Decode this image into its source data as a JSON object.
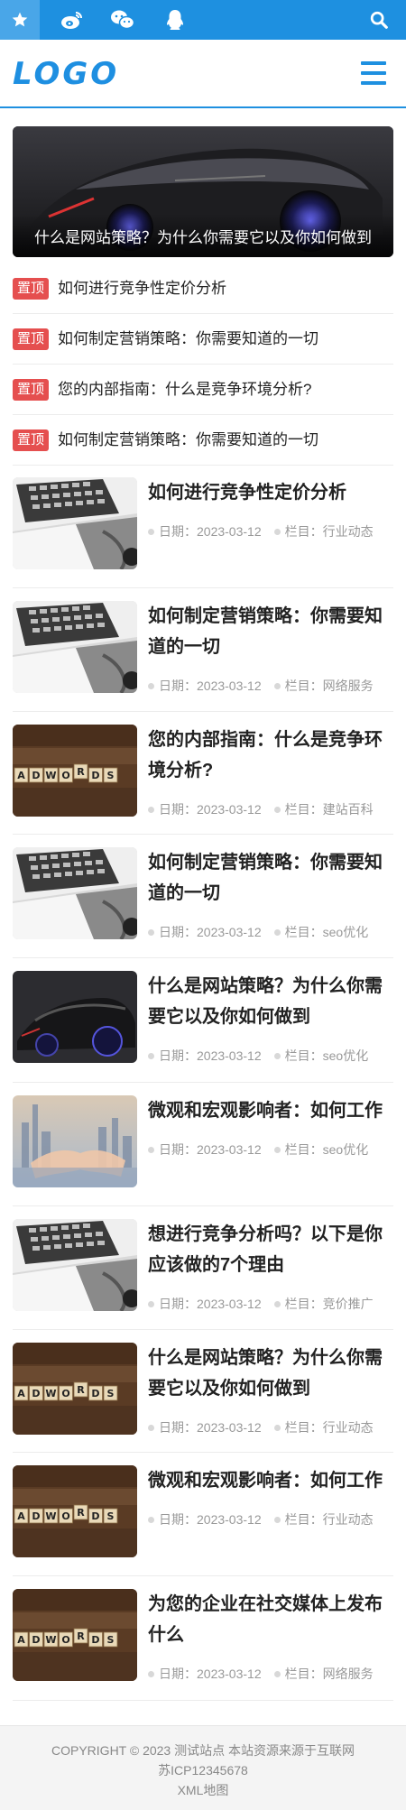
{
  "topbar": {
    "icons": [
      "star-icon",
      "weibo-icon",
      "wechat-icon",
      "qq-icon",
      "search-icon"
    ],
    "accent": "#1e90e0"
  },
  "header": {
    "logo": "LOGO",
    "menu_icon": "hamburger-menu-icon"
  },
  "banner": {
    "caption": "什么是网站策略？为什么你需要它以及你如何做到"
  },
  "pinned": {
    "badge": "置顶",
    "items": [
      {
        "title": "如何进行竞争性定价分析"
      },
      {
        "title": "如何制定营销策略：你需要知道的一切"
      },
      {
        "title": "您的内部指南：什么是竞争环境分析?"
      },
      {
        "title": "如何制定营销策略：你需要知道的一切"
      }
    ]
  },
  "articles": {
    "date_label": "日期：",
    "cat_label": "栏目：",
    "items": [
      {
        "title": "如何进行竞争性定价分析",
        "date": "2023-03-12",
        "category": "行业动态",
        "thumb": "laptop-photo"
      },
      {
        "title": "如何制定营销策略：你需要知道的一切",
        "date": "2023-03-12",
        "category": "网络服务",
        "thumb": "laptop-photo"
      },
      {
        "title": "您的内部指南：什么是竞争环境分析?",
        "date": "2023-03-12",
        "category": "建站百科",
        "thumb": "adwords-photo"
      },
      {
        "title": "如何制定营销策略：你需要知道的一切",
        "date": "2023-03-12",
        "category": "seo优化",
        "thumb": "laptop-photo"
      },
      {
        "title": "什么是网站策略？为什么你需要它以及你如何做到",
        "date": "2023-03-12",
        "category": "seo优化",
        "thumb": "car-photo"
      },
      {
        "title": "微观和宏观影响者：如何工作",
        "date": "2023-03-12",
        "category": "seo优化",
        "thumb": "handshake-photo"
      },
      {
        "title": "想进行竞争分析吗？以下是你应该做的7个理由",
        "date": "2023-03-12",
        "category": "竞价推广",
        "thumb": "laptop-photo"
      },
      {
        "title": "什么是网站策略？为什么你需要它以及你如何做到",
        "date": "2023-03-12",
        "category": "行业动态",
        "thumb": "adwords-photo"
      },
      {
        "title": "微观和宏观影响者：如何工作",
        "date": "2023-03-12",
        "category": "行业动态",
        "thumb": "adwords-photo"
      },
      {
        "title": "为您的企业在社交媒体上发布什么",
        "date": "2023-03-12",
        "category": "网络服务",
        "thumb": "adwords-photo"
      }
    ]
  },
  "adwords_text": "ADWORDS",
  "footer": {
    "line1": "COPYRIGHT © 2023 测试站点 本站资源来源于互联网",
    "line2": "苏ICP12345678",
    "line3": "XML地图"
  }
}
